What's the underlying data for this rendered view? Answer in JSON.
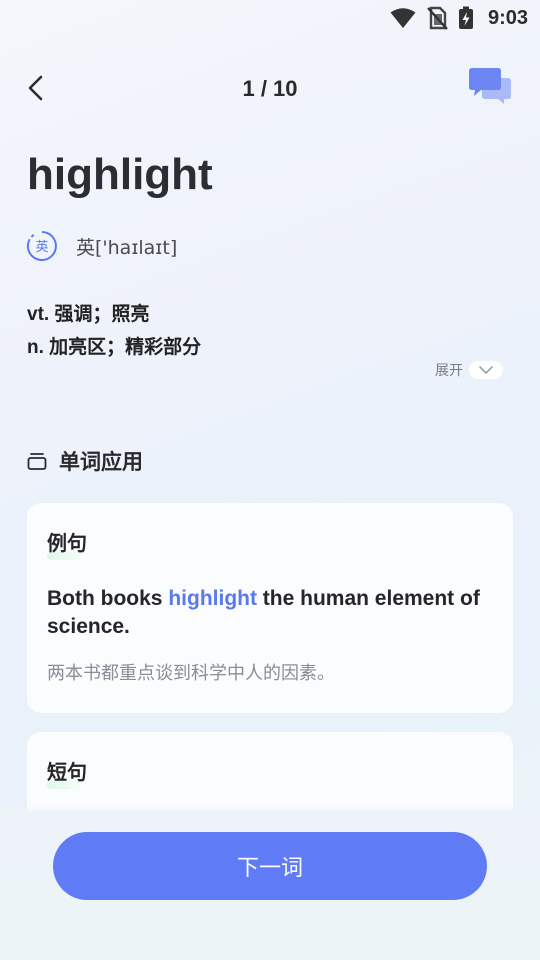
{
  "status_bar": {
    "time": "9:03",
    "icons": [
      "wifi-icon",
      "no-sim-icon",
      "battery-charging-icon"
    ]
  },
  "header": {
    "progress": "1 / 10",
    "back_icon": "chevron-left-icon",
    "chat_icon": "chat-bubbles-icon"
  },
  "word": {
    "text": "highlight",
    "accent_label": "英",
    "phonetic": "英['haɪlaɪt]",
    "definitions": [
      "vt. 强调；照亮",
      "n. 加亮区；精彩部分"
    ],
    "expand_label": "展开"
  },
  "section": {
    "title": "单词应用",
    "icon": "cards-icon"
  },
  "example_card": {
    "label": "例句",
    "sentence_before": "Both books ",
    "keyword": "highlight",
    "sentence_after": " the human element of science.",
    "translation": "两本书都重点谈到科学中人的因素。"
  },
  "short_card": {
    "label": "短句"
  },
  "footer": {
    "next_label": "下一词"
  },
  "colors": {
    "accent": "#5f7cf6",
    "keyword": "#5b78ee",
    "label_highlight": "#7ee0a5"
  }
}
